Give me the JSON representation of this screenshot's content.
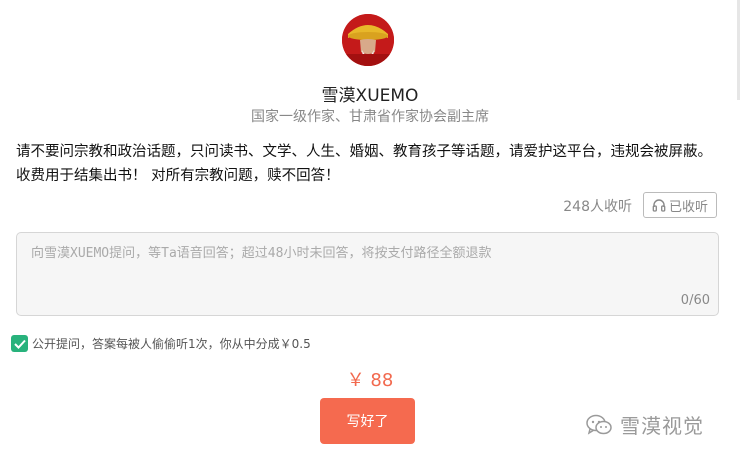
{
  "profile": {
    "name": "雪漠XUEMO",
    "title": "国家一级作家、甘肃省作家协会副主席"
  },
  "description": "请不要问宗教和政治话题，只问读书、文学、人生、婚姻、教育孩子等话题，请爱护这平台，违规会被屏蔽。收费用于结集出书！ 对所有宗教问题，赎不回答！",
  "listen": {
    "count_text": "248人收听",
    "button_label": "已收听",
    "button_icon": "headphones-icon"
  },
  "question": {
    "placeholder": "向雪漠XUEMO提问，等Ta语音回答；超过48小时未回答，将按支付路径全额退款",
    "char_count": "0/60"
  },
  "public_option": {
    "checked": true,
    "label": "公开提问，答案每被人偷偷听1次，你从中分成￥0.5"
  },
  "price": "￥ 88",
  "submit_label": "写好了",
  "watermark": {
    "icon": "wechat-icon",
    "text": "雪漠视觉"
  },
  "colors": {
    "accent": "#f56a4f",
    "checkbox": "#28b27c"
  }
}
